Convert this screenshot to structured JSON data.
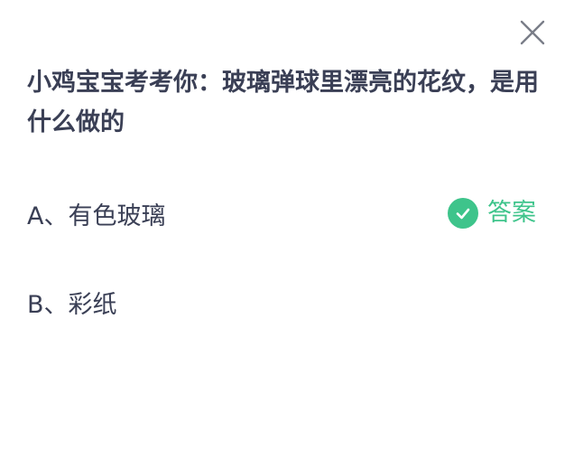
{
  "dialog": {
    "close_icon": "close-icon",
    "question": "小鸡宝宝考考你：玻璃弹球里漂亮的花纹，是用什么做的",
    "options": [
      {
        "label": "A、有色玻璃"
      },
      {
        "label": "B、彩纸"
      }
    ],
    "answer": {
      "label": "答案",
      "icon": "check-circle-icon",
      "color": "#3ec48b"
    }
  }
}
